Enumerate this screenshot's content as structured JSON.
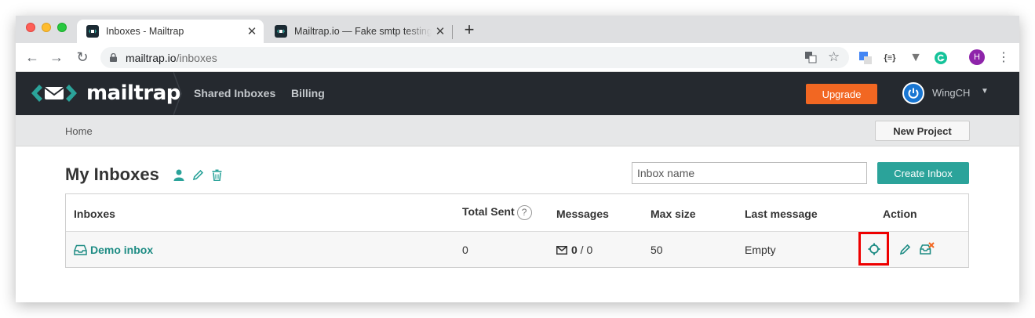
{
  "browser": {
    "tabs": [
      {
        "title": "Inboxes - Mailtrap",
        "active": true
      },
      {
        "title": "Mailtrap.io — Fake smtp testing",
        "active": false
      }
    ],
    "url_host": "mailtrap.io",
    "url_path": "/inboxes",
    "avatar_letter": "H",
    "ext_json_label": "{≡}"
  },
  "header": {
    "logo_text": "mailtrap",
    "nav": [
      "Shared Inboxes",
      "Billing"
    ],
    "upgrade_label": "Upgrade",
    "user_name": "WingCH"
  },
  "breadcrumb": {
    "home": "Home",
    "new_project_label": "New Project"
  },
  "main": {
    "title": "My Inboxes",
    "search_placeholder": "Inbox name",
    "create_label": "Create Inbox",
    "table": {
      "headers": [
        "Inboxes",
        "Total Sent",
        "Messages",
        "Max size",
        "Last message",
        "Action"
      ],
      "help_glyph": "?",
      "rows": [
        {
          "name": "Demo inbox",
          "total_sent": "0",
          "messages_unread": "0",
          "messages_sep": " / ",
          "messages_total": "0",
          "max_size": "50",
          "last_message": "Empty"
        }
      ]
    }
  },
  "colors": {
    "accent": "#2ba39a",
    "upgrade": "#f26722",
    "header_bg": "#25292f",
    "highlight": "#e00000"
  }
}
